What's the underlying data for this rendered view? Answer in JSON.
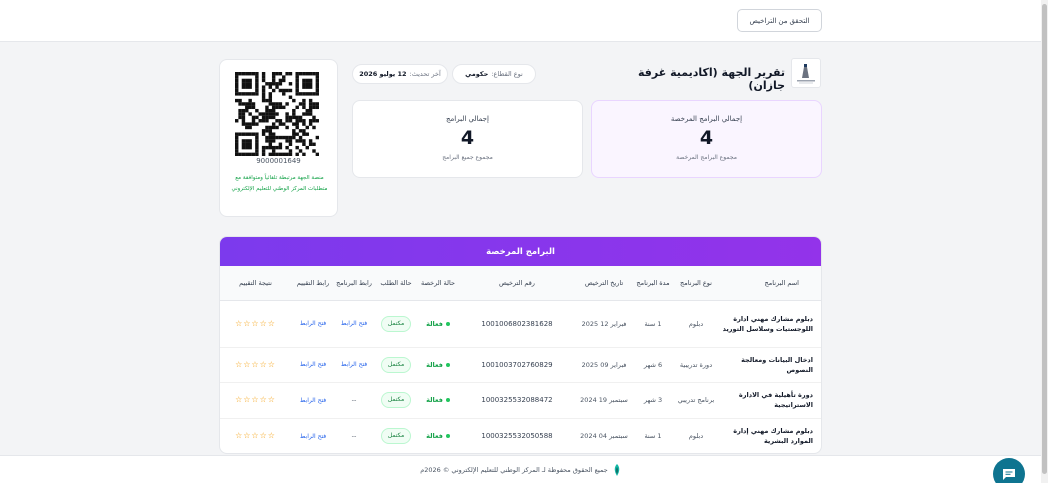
{
  "header": {
    "verify_button": "التحقق من التراخيص"
  },
  "entity": {
    "title": "تقرير الجهة (اكاديمية غرفة جازان)",
    "sector_label": "نوع القطاع:",
    "sector_value": "حكومي",
    "updated_label": "آخر تحديث:",
    "updated_value": "12 يوليو 2026"
  },
  "stats": {
    "licensed": {
      "label": "إجمالي البرامج المرخصة",
      "value": "4",
      "sub": "مجموع البرامج المرخصة"
    },
    "total": {
      "label": "إجمالي البرامج",
      "value": "4",
      "sub": "مجموع جميع البرامج"
    }
  },
  "qr": {
    "id": "9000001649",
    "note": "منصة الجهة مرتبطة تلقائياً ومتوافقة مع متطلبات المركز الوطني للتعليم الإلكتروني"
  },
  "table": {
    "title": "البرامج المرخصة",
    "headers": {
      "name": "اسم البرنامج",
      "type": "نوع البرنامج",
      "duration": "مدة البرنامج",
      "date": "تاريخ الترخيص",
      "license": "رقم الترخيص",
      "lic_status": "حالة الرخصة",
      "req_status": "حالة الطلب",
      "prog_link": "رابط البرنامج",
      "eval_link": "رابط التقييم",
      "rating": "نتيجة التقييم"
    },
    "rows": [
      {
        "name": "دبلوم مشارك مهني ادارة اللوجستيات وسلاسل التوريد",
        "type": "دبلوم",
        "duration": "1 سنة",
        "date": "فبراير 12 2025",
        "license": "1001006802381628",
        "lic_status": "فعالة",
        "req_status": "مكتمل",
        "prog_link": "فتح الرابط",
        "eval_link": "فتح الرابط",
        "rating": "☆☆☆☆☆"
      },
      {
        "name": "ادخال البيانات ومعالجة النصوص",
        "type": "دورة تدريبية",
        "duration": "6 شهر",
        "date": "فبراير 09 2025",
        "license": "1001003702760829",
        "lic_status": "فعالة",
        "req_status": "مكتمل",
        "prog_link": "فتح الرابط",
        "eval_link": "فتح الرابط",
        "rating": "☆☆☆☆☆"
      },
      {
        "name": "دورة تأهيلية في الادارة الاستراتيجية",
        "type": "برنامج تدريبي",
        "duration": "3 شهر",
        "date": "سبتمبر 19 2024",
        "license": "1000325532088472",
        "lic_status": "فعالة",
        "req_status": "مكتمل",
        "prog_link": "--",
        "eval_link": "فتح الرابط",
        "rating": "☆☆☆☆☆"
      },
      {
        "name": "دبلوم مشارك مهني إدارة الموارد البشرية",
        "type": "دبلوم",
        "duration": "1 سنة",
        "date": "سبتمبر 04 2024",
        "license": "1000325532050588",
        "lic_status": "فعالة",
        "req_status": "مكتمل",
        "prog_link": "--",
        "eval_link": "فتح الرابط",
        "rating": "☆☆☆☆☆"
      }
    ]
  },
  "footer": {
    "text": "جميع الحقوق محفوظة لـ المركز الوطني للتعليم الإلكتروني © 2026م"
  },
  "colors": {
    "accent": "#9333ea",
    "success": "#16a34a",
    "chat": "#0e7490"
  },
  "icons": {
    "chat": "chat-bubble-icon",
    "logo": "chamber-logo-icon",
    "footer": "ncel-logo-icon"
  }
}
